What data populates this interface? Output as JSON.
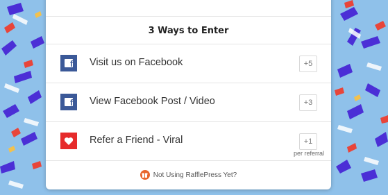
{
  "heading": "3 Ways to Enter",
  "entries": [
    {
      "label": "Visit us on Facebook",
      "points": "+5",
      "icon": "facebook-icon"
    },
    {
      "label": "View Facebook Post / Video",
      "points": "+3",
      "icon": "facebook-icon"
    },
    {
      "label": "Refer a Friend - Viral",
      "points": "+1",
      "sublabel": "per referral",
      "icon": "heart-icon"
    }
  ],
  "footer": {
    "text": "Not Using RafflePress Yet?",
    "icon": "rafflepress-logo-icon"
  },
  "colors": {
    "facebook": "#3b5998",
    "heart": "#e62b2b",
    "background": "#8fc1ea",
    "logo": "#e8662d"
  }
}
